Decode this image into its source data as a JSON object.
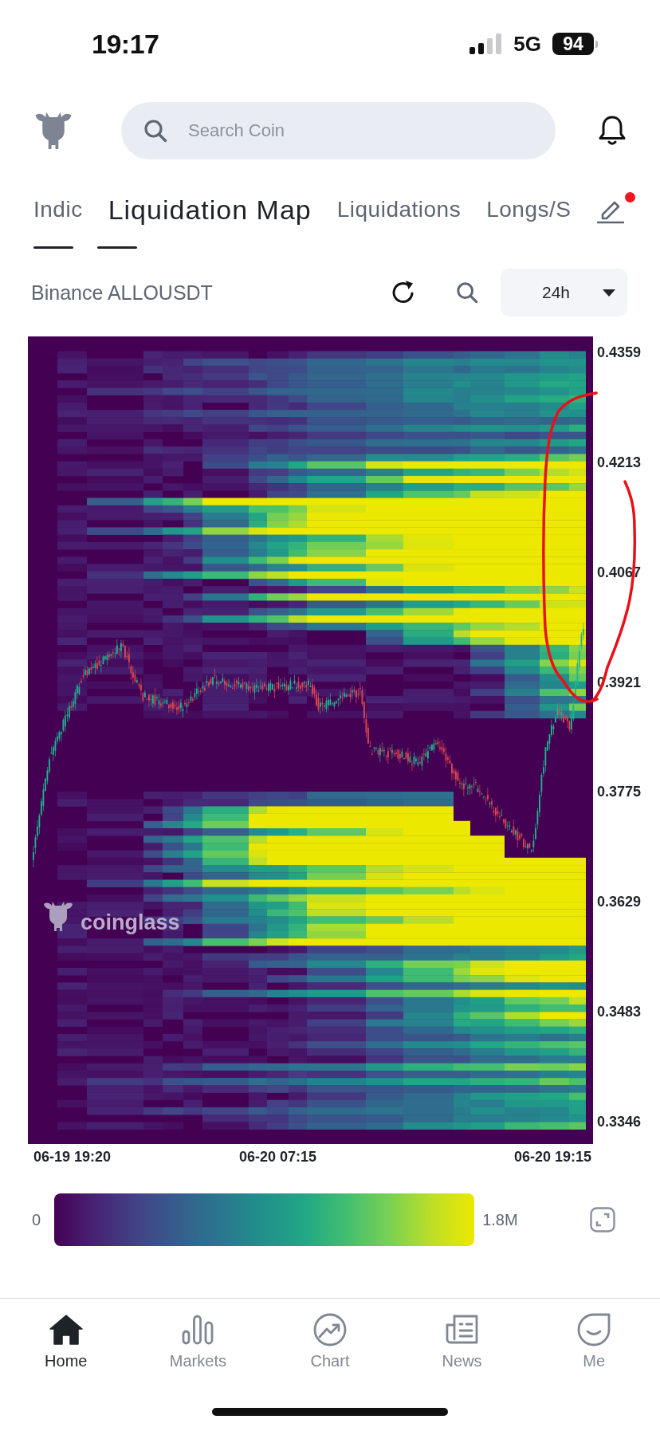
{
  "status_bar": {
    "time": "19:17",
    "network": "5G",
    "battery": "94"
  },
  "header": {
    "search": {
      "placeholder": "Search Coin"
    }
  },
  "tabs": [
    {
      "label": "Indic",
      "selected": false
    },
    {
      "label": "Liquidation Map",
      "selected": true
    },
    {
      "label": "Liquidations",
      "selected": false
    },
    {
      "label": "Longs/S",
      "selected": false
    }
  ],
  "edit": {
    "badge": true
  },
  "toolbar": {
    "pair": "Binance ALLOUSDT",
    "period": "24h"
  },
  "chart": {
    "y_labels": [
      "0.4359",
      "0.4213",
      "0.4067",
      "0.3921",
      "0.3775",
      "0.3629",
      "0.3483",
      "0.3346"
    ],
    "x_labels": [
      "06-19 19:20",
      "06-20 07:15",
      "06-20 19:15"
    ],
    "watermark": "coinglass",
    "annotations": [
      {
        "kind": "loop"
      },
      {
        "kind": "bracket"
      }
    ]
  },
  "legend": {
    "min": "0",
    "max": "1.8M"
  },
  "nav": [
    {
      "label": "Home",
      "selected": true
    },
    {
      "label": "Markets",
      "selected": false
    },
    {
      "label": "Chart",
      "selected": false
    },
    {
      "label": "News",
      "selected": false
    },
    {
      "label": "Me",
      "selected": false
    }
  ]
}
